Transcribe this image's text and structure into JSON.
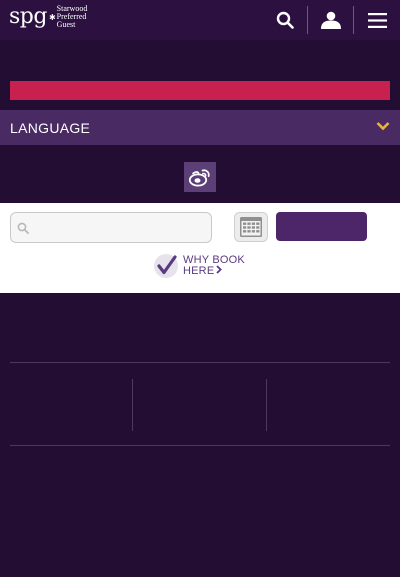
{
  "brand": {
    "mark": "spg",
    "lines": [
      "Starwood",
      "Preferred",
      "Guest"
    ]
  },
  "icons": {
    "search": "search-icon",
    "profile": "user-icon",
    "menu": "hamburger-menu-icon",
    "chevron": "chevron-down-icon",
    "weibo": "weibo-icon",
    "calendar": "calendar-icon",
    "checkmark": "checkmark-icon",
    "field_search": "magnifier-icon",
    "arrow": "chevron-right-icon"
  },
  "language": {
    "label": "LANGUAGE"
  },
  "booking": {
    "destination_value": "",
    "destination_placeholder": "",
    "submit_label": ""
  },
  "why_book": {
    "line1": "WHY BOOK",
    "line2": "HERE"
  },
  "colors": {
    "header_bg": "#2c1140",
    "page_bg": "#240d33",
    "promo": "#c8204f",
    "language_bar": "#4a2a62",
    "primary_button": "#4d2569",
    "link_text": "#5b3a80"
  }
}
